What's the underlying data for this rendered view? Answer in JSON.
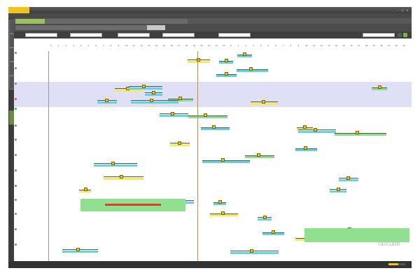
{
  "app": {
    "badge": "",
    "window_title": "",
    "menu": [
      "",
      "",
      "",
      ""
    ],
    "watermark": "railcube"
  },
  "doc_tabs": [
    {
      "label": "",
      "active": true
    },
    {
      "label": "",
      "active": false
    },
    {
      "label": "",
      "active": false
    },
    {
      "label": "",
      "active": false
    },
    {
      "label": "",
      "active": false
    }
  ],
  "sub_tabs": [
    {
      "label": "",
      "active": false
    },
    {
      "label": "",
      "active": false
    },
    {
      "label": "",
      "active": false
    },
    {
      "label": "",
      "active": false
    },
    {
      "label": "",
      "active": true
    }
  ],
  "filters": [
    {
      "label": "",
      "value": "",
      "x": 0
    },
    {
      "label": "",
      "value": "",
      "x": 1
    },
    {
      "label": "",
      "value": "",
      "x": 2
    },
    {
      "label": "",
      "value": "",
      "x": 3
    },
    {
      "label": "",
      "value": "",
      "x": 4
    }
  ],
  "timeline": {
    "range": "",
    "days": [
      "",
      ""
    ],
    "hours_day1": [
      "0",
      "1",
      "2",
      "3",
      "4",
      "5",
      "6",
      "7",
      "8",
      "9",
      "10",
      "11",
      "12",
      "13",
      "14",
      "15",
      "16",
      "17",
      "18",
      "19",
      "20",
      "21",
      "22",
      "23"
    ],
    "hours_day2": [
      "0",
      "1",
      "2",
      "3",
      "4",
      "5",
      "6",
      "7",
      "8",
      "9",
      "10",
      "11",
      "12",
      "13",
      "14",
      "15",
      "16",
      "17",
      "18",
      "19",
      "20",
      "21",
      "22",
      "23"
    ]
  },
  "rows": [
    {
      "name": "",
      "sub": [
        "",
        "",
        ""
      ],
      "tint": "#ffffff",
      "dot": "#4caf50"
    },
    {
      "name": "",
      "sub": [
        ""
      ],
      "tint": "#ffffff",
      "dot": "#4caf50"
    },
    {
      "name": "",
      "sub": [
        "",
        "",
        ""
      ],
      "tint": "#dfe0f5",
      "dot": "#4caf50"
    },
    {
      "name": "",
      "sub": [
        "",
        ""
      ],
      "tint": "#dfe0f5",
      "dot": "#d9534f"
    },
    {
      "name": "",
      "sub": [
        "",
        ""
      ],
      "tint": "#ffffff",
      "dot": "#4caf50"
    },
    {
      "name": "",
      "sub": [
        "",
        "",
        ""
      ],
      "tint": "#ffffff",
      "dot": "#4caf50"
    },
    {
      "name": "",
      "sub": [
        "",
        "",
        ""
      ],
      "tint": "#ffffff",
      "dot": "#4caf50"
    },
    {
      "name": "",
      "sub": [
        "",
        "",
        ""
      ],
      "tint": "#ffffff",
      "dot": "#4caf50"
    },
    {
      "name": "",
      "sub": [
        "",
        "",
        ""
      ],
      "tint": "#ffffff",
      "dot": "#4caf50"
    },
    {
      "name": "",
      "sub": [
        "",
        "",
        ""
      ],
      "tint": "#ffffff",
      "dot": "#d9534f"
    },
    {
      "name": "",
      "sub": [
        "",
        "",
        ""
      ],
      "tint": "#ffffff",
      "dot": "#4caf50"
    },
    {
      "name": "",
      "sub": [
        "",
        "",
        ""
      ],
      "tint": "#ffffff",
      "dot": "#4caf50"
    },
    {
      "name": "",
      "sub": [
        "",
        "",
        ""
      ],
      "tint": "#ffffff",
      "dot": "#4caf50"
    },
    {
      "name": "",
      "sub": [
        "",
        "",
        ""
      ],
      "tint": "#ffffff",
      "dot": "#4caf50"
    }
  ],
  "colors": {
    "cyan": "#5fd6e0",
    "green": "#8fe08f",
    "yellow": "#f5ea5a",
    "red": "#e23a2e",
    "light_blue": "#cfeff3",
    "now_line": "#d78b2c",
    "accent": "#9dc15a"
  },
  "status": {
    "left": "",
    "mid": "",
    "right": "",
    "progress": 0.6
  }
}
